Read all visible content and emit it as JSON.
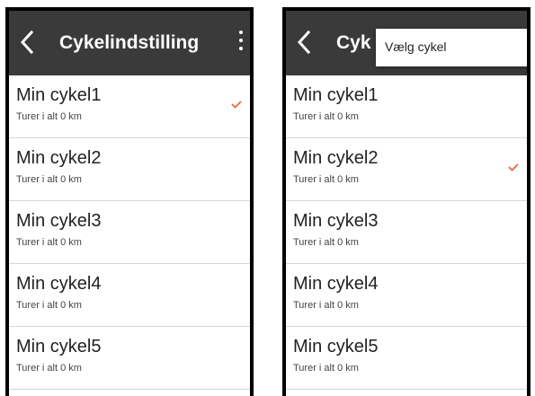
{
  "colors": {
    "appbar": "#3a3a3a",
    "accent_check": "#e8663a",
    "divider": "#d6d6d6"
  },
  "left_screen": {
    "appbar": {
      "title": "Cykelindstilling",
      "back_icon": "chevron-left-icon",
      "menu_icon": "more-vert-icon"
    },
    "items": [
      {
        "name": "Min cykel1",
        "subtitle": "Turer i alt 0 km",
        "selected": true
      },
      {
        "name": "Min cykel2",
        "subtitle": "Turer i alt 0 km",
        "selected": false
      },
      {
        "name": "Min cykel3",
        "subtitle": "Turer i alt 0 km",
        "selected": false
      },
      {
        "name": "Min cykel4",
        "subtitle": "Turer i alt 0 km",
        "selected": false
      },
      {
        "name": "Min cykel5",
        "subtitle": "Turer i alt 0 km",
        "selected": false
      }
    ]
  },
  "right_screen": {
    "appbar": {
      "title": "Cyk",
      "back_icon": "chevron-left-icon"
    },
    "popup_menu": {
      "items": [
        "Vælg cykel"
      ]
    },
    "items": [
      {
        "name": "Min cykel1",
        "subtitle": "Turer i alt 0 km",
        "selected": false
      },
      {
        "name": "Min cykel2",
        "subtitle": "Turer i alt 0 km",
        "selected": true
      },
      {
        "name": "Min cykel3",
        "subtitle": "Turer i alt 0 km",
        "selected": false
      },
      {
        "name": "Min cykel4",
        "subtitle": "Turer i alt 0 km",
        "selected": false
      },
      {
        "name": "Min cykel5",
        "subtitle": "Turer i alt 0 km",
        "selected": false
      }
    ]
  }
}
